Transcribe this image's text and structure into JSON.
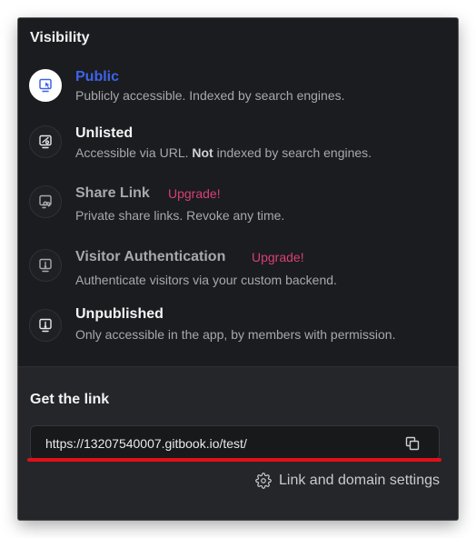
{
  "visibility": {
    "title": "Visibility",
    "options": [
      {
        "title": "Public",
        "description": "Publicly accessible. Indexed by search engines.",
        "icon": "visibility-public-icon",
        "state": "selected"
      },
      {
        "title": "Unlisted",
        "description_pre": "Accessible via URL. ",
        "description_bold": "Not",
        "description_post": " indexed by search engines.",
        "icon": "visibility-unlisted-icon"
      },
      {
        "title": "Share Link",
        "badge": "Upgrade!",
        "description": "Private share links. Revoke any time.",
        "icon": "share-link-icon",
        "state": "locked"
      },
      {
        "title": "Visitor Authentication",
        "badge": "Upgrade!",
        "description": "Authenticate visitors via your custom backend.",
        "icon": "visitor-auth-icon",
        "state": "locked"
      },
      {
        "title": "Unpublished",
        "description": "Only accessible in the app, by members with permission.",
        "icon": "unpublished-icon"
      }
    ]
  },
  "link": {
    "title": "Get the link",
    "url": "https://13207540007.gitbook.io/test/",
    "copy_icon": "copy-icon",
    "settings_label": "Link and domain settings",
    "settings_icon": "gear-icon"
  },
  "colors": {
    "panel_bg": "#1b1c1f",
    "bottom_bg": "#25262a",
    "accent": "#3d63ea",
    "upgrade": "#d64074",
    "highlight_underline": "#e0101a"
  }
}
